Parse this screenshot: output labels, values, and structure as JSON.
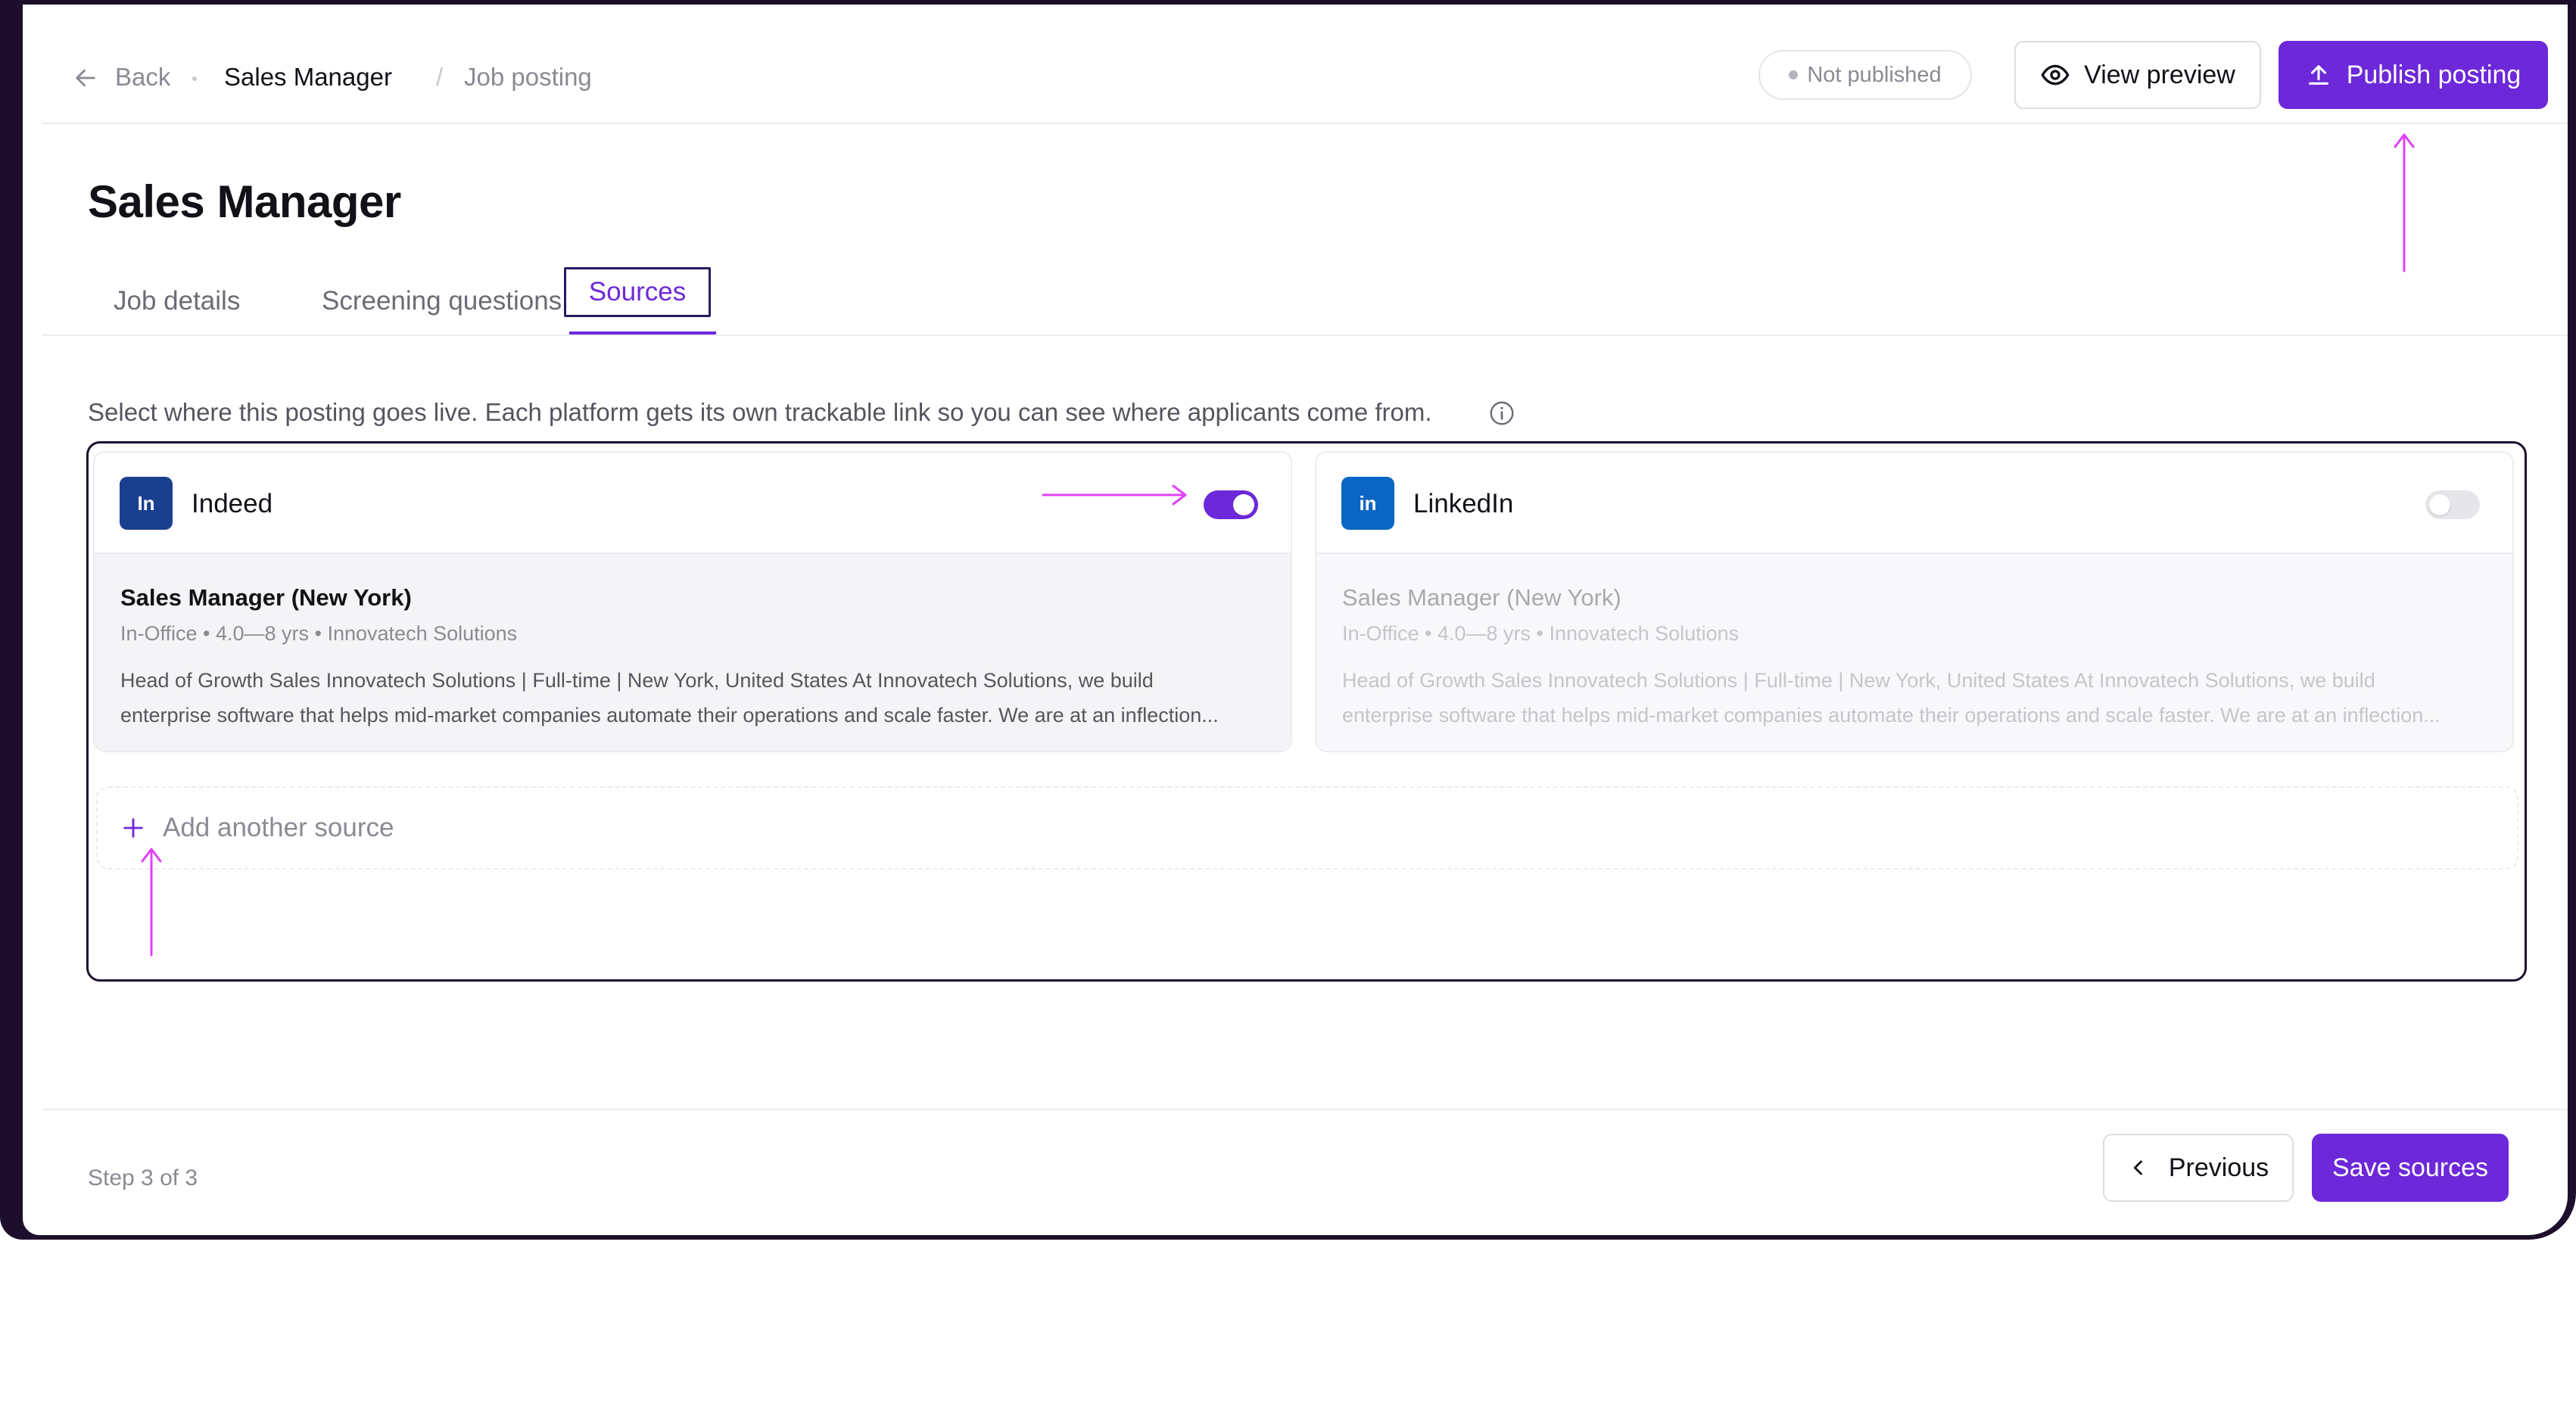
{
  "header": {
    "back_label": "Back",
    "crumb_current": "Sales Manager",
    "crumb_separator": "/",
    "crumb_section": "Job posting",
    "status_badge": "Not published",
    "view_preview_label": "View preview",
    "publish_label": "Publish posting"
  },
  "page": {
    "title": "Sales Manager",
    "tabs": [
      {
        "label": "Job details",
        "active": false
      },
      {
        "label": "Screening questions",
        "active": false
      },
      {
        "label": "Sources",
        "active": true
      }
    ],
    "description": "Select where this posting goes live. Each platform gets its own trackable link so you can see where applicants come from."
  },
  "sources": [
    {
      "logo_text": "In",
      "name": "Indeed",
      "enabled": true,
      "logo_color": "#1b3f8f",
      "job_title": "Sales Manager (New York)",
      "meta": "In-Office • 4.0—8 yrs • Innovatech Solutions",
      "desc_line1": "Head of Growth Sales Innovatech Solutions | Full-time | New York, United States At Innovatech Solutions, we build",
      "desc_line2": "enterprise software that helps mid-market companies automate their operations and scale faster. We are at an inflection..."
    },
    {
      "logo_text": "in",
      "name": "LinkedIn",
      "enabled": false,
      "logo_color": "#0a66c2",
      "job_title": "Sales Manager (New York)",
      "meta": "In-Office • 4.0—8 yrs • Innovatech Solutions",
      "desc_line1": "Head of Growth Sales Innovatech Solutions | Full-time | New York, United States At Innovatech Solutions, we build",
      "desc_line2": "enterprise software that helps mid-market companies automate their operations and scale faster. We are at an inflection..."
    }
  ],
  "add_source_label": "Add another source",
  "footer": {
    "step_text": "Step 3 of 3",
    "previous_label": "Previous",
    "save_label": "Save sources"
  },
  "colors": {
    "accent": "#6d28d9",
    "annotation": "#e040fb",
    "frame": "#1d0f2c"
  },
  "icons": {
    "back": "arrow-left-icon",
    "preview": "eye-icon",
    "publish": "upload-icon",
    "info": "info-icon",
    "add": "plus-icon",
    "previous": "chevron-left-icon"
  }
}
